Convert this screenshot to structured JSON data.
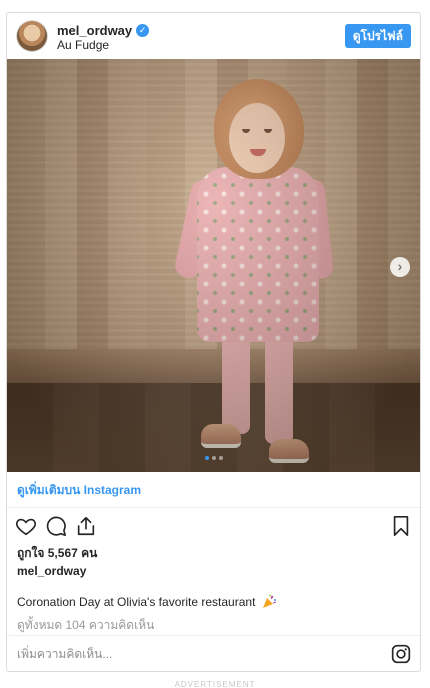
{
  "header": {
    "username": "mel_ordway",
    "verified_icon": "check-icon",
    "location": "Au Fudge",
    "profile_button": "ดูโปรไฟล์"
  },
  "media": {
    "next_icon": "chevron-right-icon",
    "carousel": {
      "total": 3,
      "active": 1
    }
  },
  "view_more": "ดูเพิ่มเติมบน Instagram",
  "actions": {
    "like_icon": "heart-icon",
    "comment_icon": "comment-icon",
    "share_icon": "share-icon",
    "save_icon": "bookmark-icon"
  },
  "likes": "ถูกใจ 5,567 คน",
  "caption": {
    "username": "mel_ordway",
    "text": "Coronation Day at Olivia's favorite restaurant",
    "emoji_icon": "party-popper-icon"
  },
  "comments_link": "ดูทั้งหมด 104 ความคิดเห็น",
  "comment_box": {
    "placeholder": "เพิ่มความคิดเห็น...",
    "brand_icon": "instagram-icon"
  },
  "footer": "ADVERTISEMENT",
  "colors": {
    "accent": "#3897f0",
    "text": "#262626",
    "muted": "#999999",
    "border": "#dbdbdb"
  }
}
